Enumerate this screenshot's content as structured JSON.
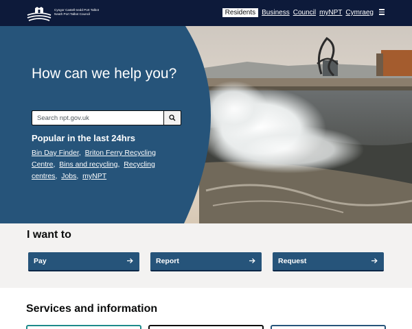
{
  "header": {
    "logo_welsh": "Cyngor Castell-nedd Port Talbot",
    "logo_english": "Neath Port Talbot Council",
    "nav": [
      {
        "label": "Residents",
        "active": true
      },
      {
        "label": "Business"
      },
      {
        "label": "Council"
      },
      {
        "label": "myNPT"
      },
      {
        "label": "Cymraeg"
      }
    ]
  },
  "hero": {
    "title": "How can we help you?",
    "search_placeholder": "Search npt.gov.uk",
    "popular_title": "Popular in the last 24hrs",
    "popular_links": [
      "Bin Day Finder",
      "Briton Ferry Recycling Centre",
      "Bins and recycling",
      "Recycling centres",
      "Jobs",
      "myNPT"
    ]
  },
  "iwant": {
    "title": "I want to",
    "actions": [
      "Pay",
      "Report",
      "Request"
    ]
  },
  "services": {
    "title": "Services and information"
  },
  "colors": {
    "header_bg": "#0d1a3a",
    "hero_panel": "#26547a",
    "action_bg": "#26547a",
    "section_bg": "#f3f2f1"
  },
  "icons": [
    "council-logo-icon",
    "menu-icon",
    "search-icon",
    "arrow-right-icon"
  ]
}
